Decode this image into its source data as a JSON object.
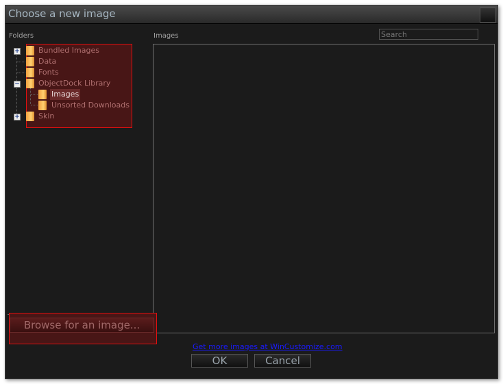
{
  "window": {
    "title": "Choose a new image"
  },
  "folders_label": "Folders",
  "images_label": "Images",
  "search": {
    "placeholder": "Search",
    "value": ""
  },
  "tree": {
    "items": [
      {
        "label": "Bundled Images",
        "expander": "+"
      },
      {
        "label": "Data"
      },
      {
        "label": "Fonts"
      },
      {
        "label": "ObjectDock Library",
        "expander": "−"
      },
      {
        "label": "Images",
        "selected": true
      },
      {
        "label": "Unsorted Downloads"
      },
      {
        "label": "Skin",
        "expander": "+"
      }
    ]
  },
  "browse_button": "Browse for an image...",
  "link": "Get more images at WinCustomize.com",
  "ok_button": "OK",
  "cancel_button": "Cancel",
  "colors": {
    "highlight_border": "#e01010",
    "highlight_fill": "#481616",
    "link": "#1a1aff"
  }
}
